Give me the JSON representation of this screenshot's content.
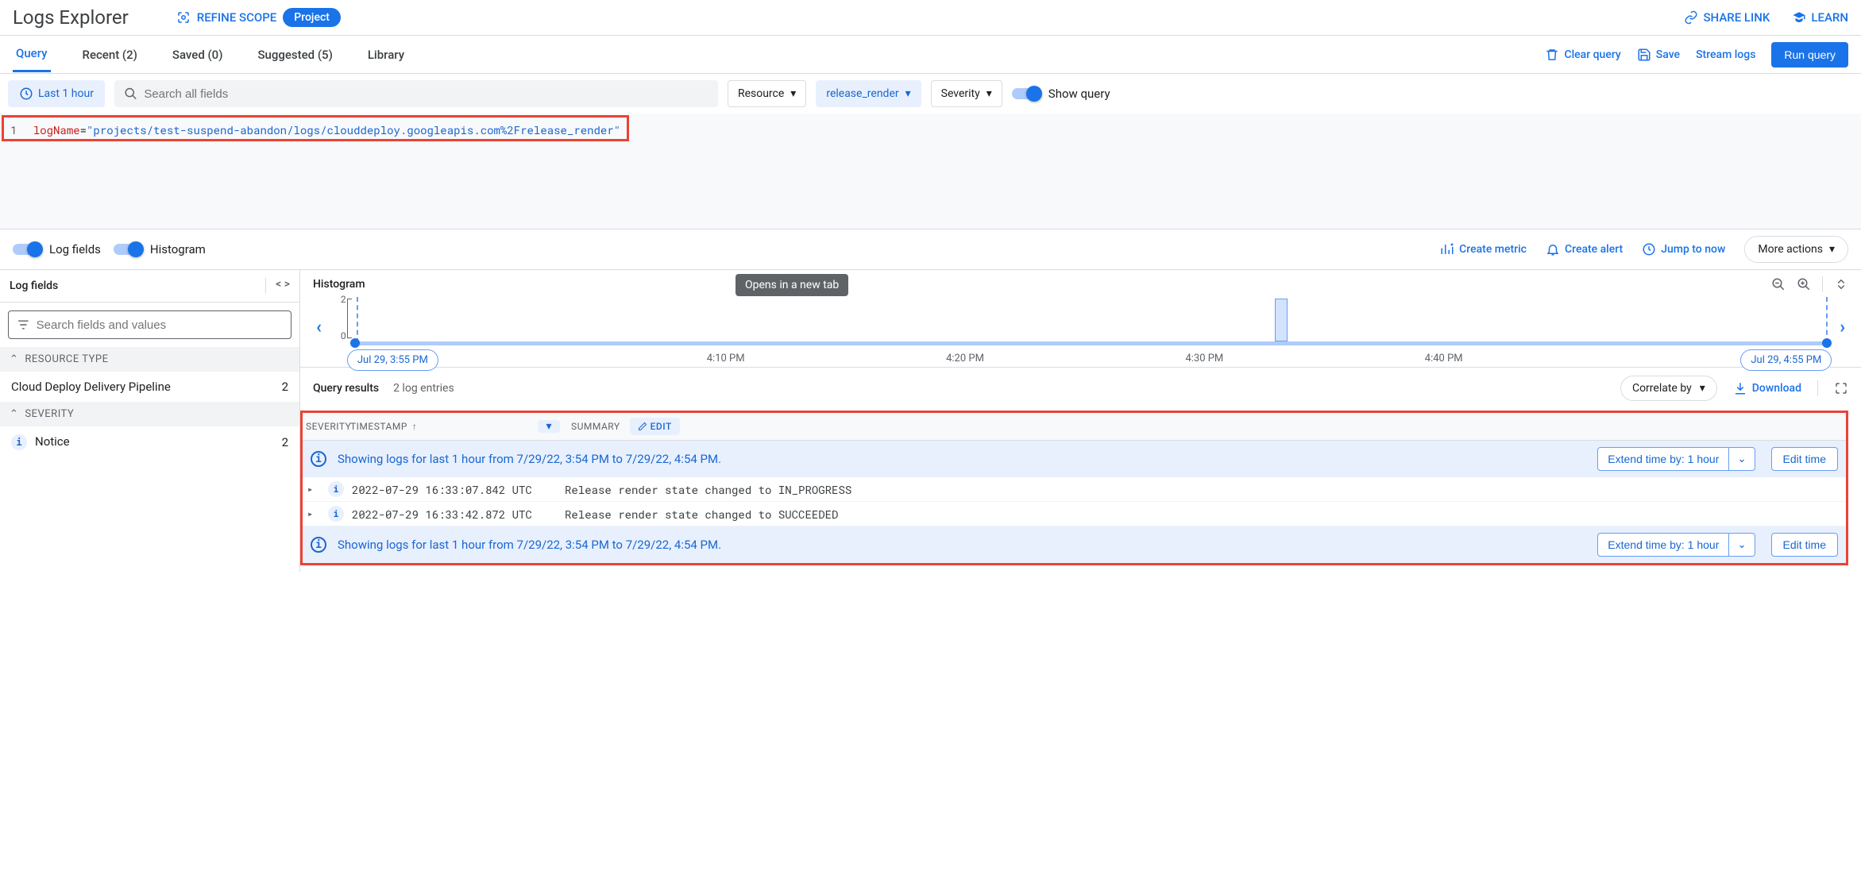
{
  "header": {
    "title": "Logs Explorer",
    "refine_scope": "REFINE SCOPE",
    "project_pill": "Project",
    "share_link": "SHARE LINK",
    "learn": "LEARN"
  },
  "tabs": {
    "items": [
      {
        "label": "Query",
        "active": true
      },
      {
        "label": "Recent (2)",
        "active": false
      },
      {
        "label": "Saved (0)",
        "active": false
      },
      {
        "label": "Suggested (5)",
        "active": false
      },
      {
        "label": "Library",
        "active": false
      }
    ],
    "clear": "Clear query",
    "save": "Save",
    "stream": "Stream logs",
    "run": "Run query"
  },
  "filters": {
    "time": "Last 1 hour",
    "search_placeholder": "Search all fields",
    "resource": "Resource",
    "log_name": "release_render",
    "severity": "Severity",
    "show_query": "Show query"
  },
  "query": {
    "line_num": "1",
    "key": "logName",
    "eq": "=",
    "value": "\"projects/test-suspend-abandon/logs/clouddeploy.googleapis.com%2Frelease_render\""
  },
  "toggles": {
    "log_fields": "Log fields",
    "histogram": "Histogram"
  },
  "mid_actions": {
    "metric": "Create metric",
    "alert": "Create alert",
    "jump": "Jump to now",
    "more": "More actions",
    "tooltip": "Opens in a new tab"
  },
  "sidebar": {
    "title": "Log fields",
    "search_placeholder": "Search fields and values",
    "section_resource": "RESOURCE TYPE",
    "resource_item": "Cloud Deploy Delivery Pipeline",
    "resource_count": "2",
    "section_severity": "SEVERITY",
    "severity_item": "Notice",
    "severity_count": "2"
  },
  "histogram": {
    "title": "Histogram",
    "y_top": "2",
    "y_bot": "0",
    "start_pill": "Jul 29, 3:55 PM",
    "end_pill": "Jul 29, 4:55 PM",
    "ticks": [
      "4:10 PM",
      "4:20 PM",
      "4:30 PM",
      "4:40 PM"
    ]
  },
  "results": {
    "title": "Query results",
    "count": "2 log entries",
    "correlate": "Correlate by",
    "download": "Download",
    "col_sev": "SEVERITY",
    "col_ts": "TIMESTAMP",
    "col_sum": "SUMMARY",
    "edit": "EDIT",
    "info_text": "Showing logs for last 1 hour from 7/29/22, 3:54 PM to 7/29/22, 4:54 PM.",
    "extend": "Extend time by: 1 hour",
    "edit_time": "Edit time",
    "rows": [
      {
        "ts": "2022-07-29 16:33:07.842 UTC",
        "msg": "Release render state changed to IN_PROGRESS"
      },
      {
        "ts": "2022-07-29 16:33:42.872 UTC",
        "msg": "Release render state changed to SUCCEEDED"
      }
    ]
  }
}
